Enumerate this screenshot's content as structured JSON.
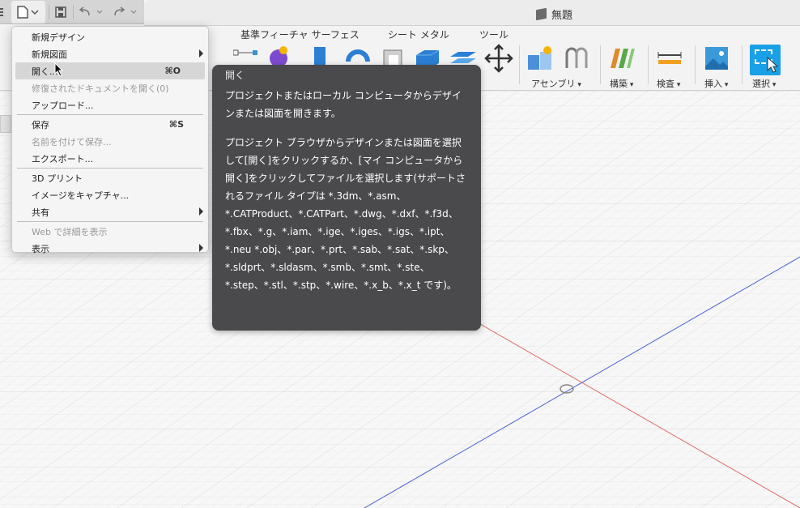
{
  "document": {
    "title": "無題"
  },
  "quick_access": {
    "items": [
      "file-menu-icon",
      "save-icon",
      "undo-icon",
      "redo-icon"
    ]
  },
  "ribbon": {
    "tabs": [
      "基準フィーチャ サーフェス",
      "シート メタル",
      "ツール"
    ],
    "groups": [
      {
        "label": "アセンブリ",
        "icon": "assembly-icon"
      },
      {
        "label": "構築",
        "icon": "construct-icon"
      },
      {
        "label": "検査",
        "icon": "inspect-icon"
      },
      {
        "label": "挿入",
        "icon": "insert-icon"
      },
      {
        "label": "選択",
        "icon": "select-icon"
      }
    ]
  },
  "file_menu": {
    "items": [
      {
        "label": "新規デザイン"
      },
      {
        "label": "新規図面",
        "submenu": true
      },
      {
        "label": "開く...",
        "shortcut": "⌘O",
        "hover": true
      },
      {
        "label": "修復されたドキュメントを開く(0)",
        "disabled": true
      },
      {
        "label": "アップロード..."
      },
      {
        "label": "保存",
        "shortcut": "⌘S"
      },
      {
        "label": "名前を付けて保存...",
        "disabled": true
      },
      {
        "label": "エクスポート..."
      },
      {
        "label": "3D プリント"
      },
      {
        "label": "イメージをキャプチャ..."
      },
      {
        "label": "共有",
        "submenu": true
      },
      {
        "label": "Web で詳細を表示",
        "disabled": true
      },
      {
        "label": "表示",
        "submenu": true
      }
    ]
  },
  "tooltip": {
    "title": "開く",
    "para1": "プロジェクトまたはローカル コンピュータからデザインまたは図面を開きます。",
    "para2": "プロジェクト ブラウザからデザインまたは図面を選択して[開く]をクリックするか、[マイ コンピュータから開く]をクリックしてファイルを選択します(サポートされるファイル タイプは *.3dm、*.asm、*.CATProduct、*.CATPart、*.dwg、*.dxf、*.f3d、*.fbx、*.g、*.iam、*.ige、*.iges、*.igs、*.ipt、*.neu *.obj、*.par、*.prt、*.sab、*.sat、*.skp、*.sldprt、*.sldasm、*.smb、*.smt、*.ste、*.step、*.stl、*.stp、*.wire、*.x_b、*.x_t です)。"
  },
  "colors": {
    "accent": "#1aa0e6",
    "menu_hover": "#d6d6d6",
    "tooltip_bg": "#4a4a4c",
    "axis_red": "#e06a6a",
    "axis_blue": "#4b5fd1"
  }
}
